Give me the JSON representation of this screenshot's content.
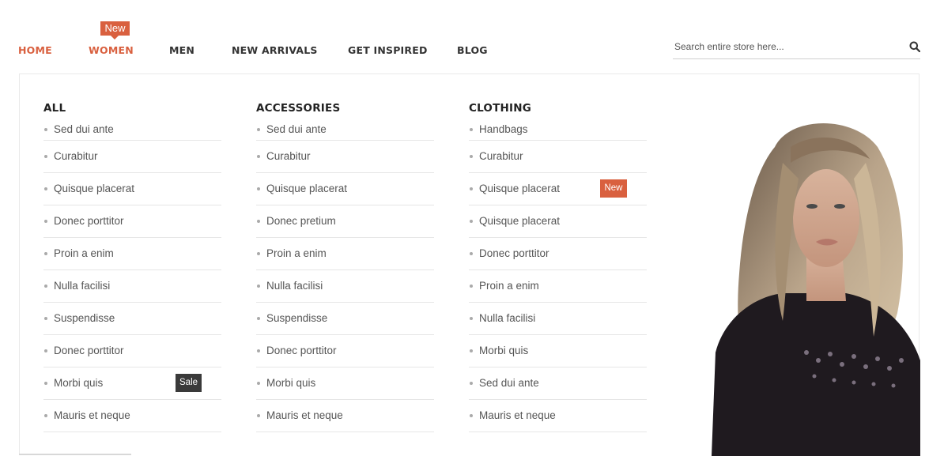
{
  "nav": {
    "items": [
      {
        "label": "HOME",
        "active": true
      },
      {
        "label": "WOMEN",
        "active": true
      },
      {
        "label": "MEN",
        "active": false
      },
      {
        "label": "NEW ARRIVALS",
        "active": false
      },
      {
        "label": "GET INSPIRED",
        "active": false
      },
      {
        "label": "BLOG",
        "active": false
      }
    ],
    "women_badge": "New"
  },
  "search": {
    "placeholder": "Search entire store here...",
    "icon": "search-icon"
  },
  "menu": {
    "columns": [
      {
        "title": "ALL",
        "items": [
          "Sed dui ante",
          "Curabitur",
          "Quisque placerat",
          "Donec porttitor",
          "Proin a enim",
          "Nulla facilisi",
          "Suspendisse",
          "Donec porttitor",
          "Morbi quis",
          "Mauris et neque"
        ],
        "tag": {
          "index": 8,
          "label": "Sale"
        }
      },
      {
        "title": "ACCESSORIES",
        "items": [
          "Sed dui ante",
          "Curabitur",
          "Quisque placerat",
          "Donec pretium",
          "Proin a enim",
          "Nulla facilisi",
          "Suspendisse",
          "Donec porttitor",
          "Morbi quis",
          "Mauris et neque"
        ]
      },
      {
        "title": "CLOTHING",
        "items": [
          "Handbags",
          "Curabitur",
          "Quisque placerat",
          "Quisque placerat",
          "Donec porttitor",
          "Proin a enim",
          "Nulla facilisi",
          "Morbi quis",
          "Sed dui ante",
          "Mauris et neque"
        ],
        "tag": {
          "index": 2,
          "label": "New"
        }
      }
    ]
  },
  "colors": {
    "accent": "#d9603f",
    "sale": "#3a3a3a"
  }
}
